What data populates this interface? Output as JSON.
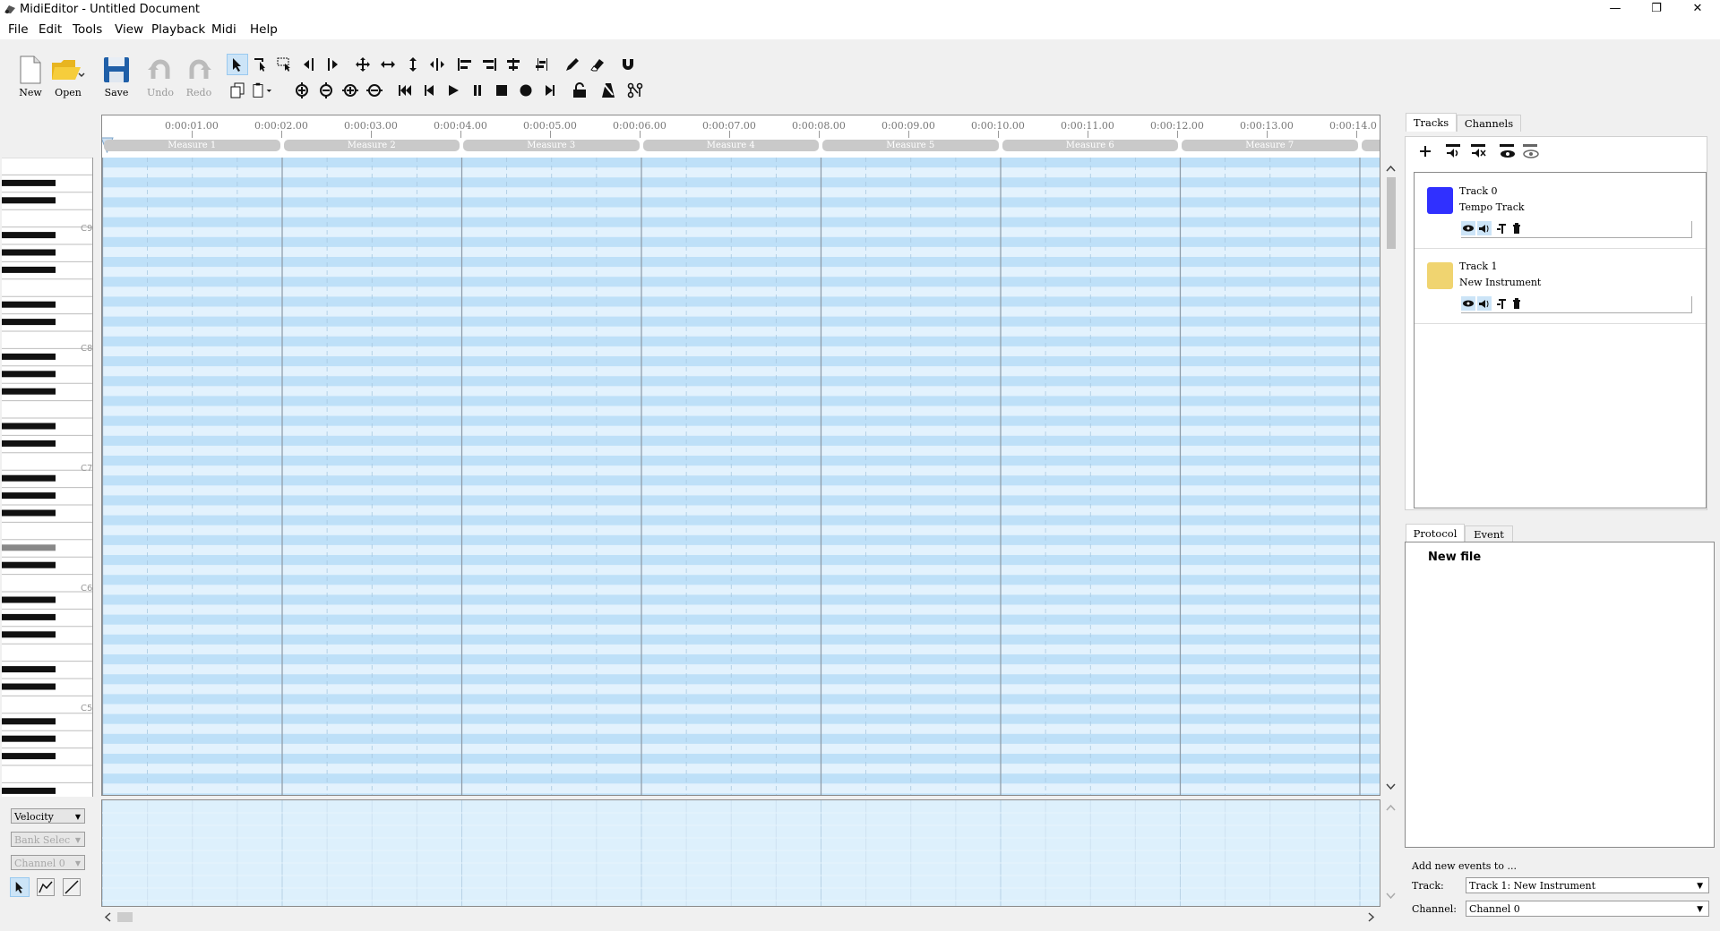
{
  "window": {
    "title": "MidiEditor - Untitled Document",
    "controls": {
      "minimize": "—",
      "maximize": "❐",
      "close": "✕"
    }
  },
  "menu": [
    "File",
    "Edit",
    "Tools",
    "View",
    "Playback",
    "Midi",
    "Help"
  ],
  "toolbar": {
    "new_label": "New",
    "open_label": "Open",
    "save_label": "Save",
    "undo_label": "Undo",
    "redo_label": "Redo"
  },
  "ruler": {
    "time_labels": [
      "0:00:01.00",
      "0:00:02.00",
      "0:00:03.00",
      "0:00:04.00",
      "0:00:05.00",
      "0:00:06.00",
      "0:00:07.00",
      "0:00:08.00",
      "0:00:09.00",
      "0:00:10.00",
      "0:00:11.00",
      "0:00:12.00",
      "0:00:13.00",
      "0:00:14.0"
    ],
    "measures": [
      "Measure 1",
      "Measure 2",
      "Measure 3",
      "Measure 4",
      "Measure 5",
      "Measure 6",
      "Measure 7"
    ]
  },
  "piano": {
    "octave_labels": [
      "C9",
      "C8",
      "C7",
      "C6",
      "C5"
    ]
  },
  "lower_controls": {
    "velocity": "Velocity",
    "bank_select": "Bank Selec",
    "channel": "Channel 0"
  },
  "tracks_panel": {
    "tabs": [
      "Tracks",
      "Channels"
    ],
    "tracks": [
      {
        "number": "Track 0",
        "name": "Tempo Track",
        "color": "#3030ff"
      },
      {
        "number": "Track 1",
        "name": "New Instrument",
        "color": "#f0d470"
      }
    ]
  },
  "protocol_panel": {
    "tabs": [
      "Protocol",
      "Event"
    ],
    "entries": [
      "New file"
    ]
  },
  "add_events": {
    "heading": "Add new events to ...",
    "track_label": "Track:",
    "track_value": "Track 1: New Instrument",
    "channel_label": "Channel:",
    "channel_value": "Channel 0"
  },
  "colors": {
    "grid_row_dark": "#bee0f8",
    "grid_row_light": "#e3f2fd",
    "selection": "#cce4f7"
  }
}
